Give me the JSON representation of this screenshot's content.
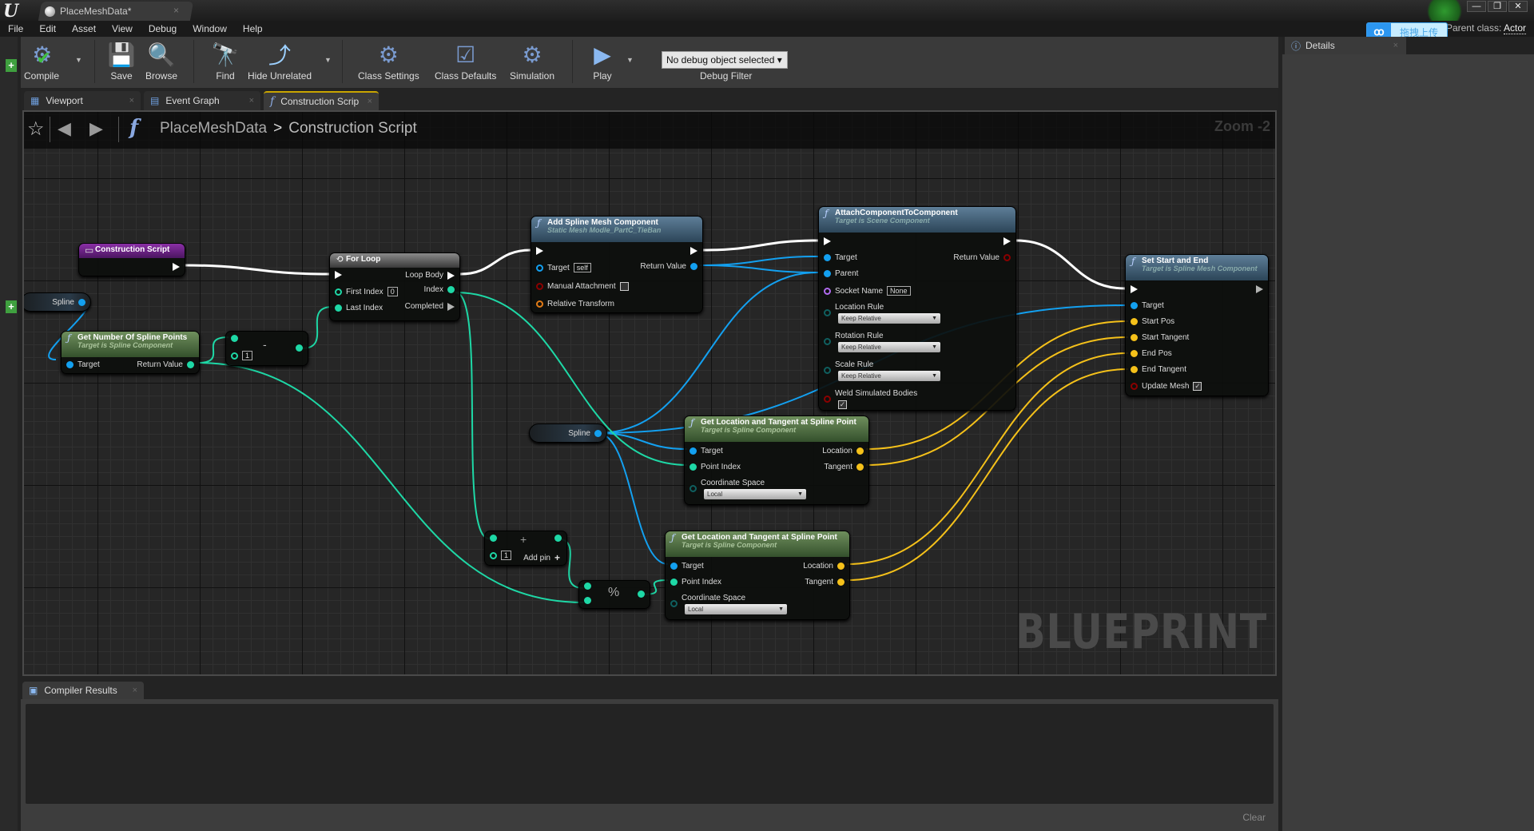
{
  "window": {
    "app_logo": "U",
    "doc_tab_title": "PlaceMeshData*",
    "doc_tab_close": "×",
    "controls": [
      "—",
      "❐",
      "✕"
    ],
    "parent_class_label": "Parent class:",
    "parent_class_value": "Actor"
  },
  "overlay": {
    "upload_button_label": "拖拽上传"
  },
  "menu": [
    "File",
    "Edit",
    "Asset",
    "View",
    "Debug",
    "Window",
    "Help"
  ],
  "toolbar": {
    "compile": "Compile",
    "save": "Save",
    "browse": "Browse",
    "find": "Find",
    "hide_unrelated": "Hide Unrelated",
    "class_settings": "Class Settings",
    "class_defaults": "Class Defaults",
    "simulation": "Simulation",
    "play": "Play",
    "debug_select": "No debug object selected",
    "debug_filter_label": "Debug Filter"
  },
  "editor_tabs": [
    {
      "label": "Viewport",
      "active": false
    },
    {
      "label": "Event Graph",
      "active": false
    },
    {
      "label": "Construction Scrip",
      "active": true
    }
  ],
  "graph": {
    "breadcrumb_root": "PlaceMeshData",
    "breadcrumb_sep": ">",
    "breadcrumb_current": "Construction Script",
    "zoom_label": "Zoom -2",
    "watermark": "BLUEPRINT",
    "nodes": {
      "construction_script": {
        "title": "Construction Script"
      },
      "spline_var_1": {
        "label": "Spline"
      },
      "get_num_points": {
        "title": "Get Number Of Spline Points",
        "subtitle": "Target is Spline Component",
        "in": "Target",
        "out": "Return Value"
      },
      "subtract": {
        "symbol": "-",
        "b_value": "1"
      },
      "for_loop": {
        "title": "For Loop",
        "loop_body": "Loop Body",
        "first_index": "First Index",
        "first_index_value": "0",
        "index": "Index",
        "last_index": "Last Index",
        "completed": "Completed"
      },
      "add_spline_mesh": {
        "title": "Add Spline Mesh Component",
        "subtitle": "Static Mesh Modle_PartC_TieBan",
        "target": "Target",
        "target_value": "self",
        "return_value": "Return Value",
        "manual_attachment": "Manual Attachment",
        "relative_transform": "Relative Transform"
      },
      "attach": {
        "title": "AttachComponentToComponent",
        "subtitle": "Target is Scene Component",
        "target": "Target",
        "return_value": "Return Value",
        "parent": "Parent",
        "socket_name": "Socket Name",
        "socket_value": "None",
        "location_rule": "Location Rule",
        "location_rule_value": "Keep Relative",
        "rotation_rule": "Rotation Rule",
        "rotation_rule_value": "Keep Relative",
        "scale_rule": "Scale Rule",
        "scale_rule_value": "Keep Relative",
        "weld": "Weld Simulated Bodies",
        "weld_checked": true
      },
      "set_start_end": {
        "title": "Set Start and End",
        "subtitle": "Target is Spline Mesh Component",
        "target": "Target",
        "start_pos": "Start Pos",
        "start_tangent": "Start Tangent",
        "end_pos": "End Pos",
        "end_tangent": "End Tangent",
        "update_mesh": "Update Mesh",
        "update_checked": true
      },
      "spline_var_2": {
        "label": "Spline"
      },
      "get_loc_1": {
        "title": "Get Location and Tangent at Spline Point",
        "subtitle": "Target is Spline Component",
        "target": "Target",
        "point_index": "Point Index",
        "location": "Location",
        "tangent": "Tangent",
        "coord_space": "Coordinate Space",
        "coord_value": "Local"
      },
      "add": {
        "symbol": "+",
        "b_value": "1",
        "add_pin": "Add pin"
      },
      "modulo": {
        "symbol": "%"
      },
      "get_loc_2": {
        "title": "Get Location and Tangent at Spline Point",
        "subtitle": "Target is Spline Component",
        "target": "Target",
        "point_index": "Point Index",
        "location": "Location",
        "tangent": "Tangent",
        "coord_space": "Coordinate Space",
        "coord_value": "Local"
      }
    }
  },
  "bottom": {
    "tab_label": "Compiler Results",
    "clear": "Clear"
  },
  "details": {
    "tab_label": "Details"
  },
  "colors": {
    "exec": "#ffffff",
    "object_pin": "#13a0f0",
    "int_pin": "#1ed8a6",
    "vector_pin": "#f5c11a",
    "bool_pin": "#8b0000",
    "name_pin": "#b16bf0",
    "transform_pin": "#e17a16",
    "enum_pin": "#0f5f5f"
  }
}
